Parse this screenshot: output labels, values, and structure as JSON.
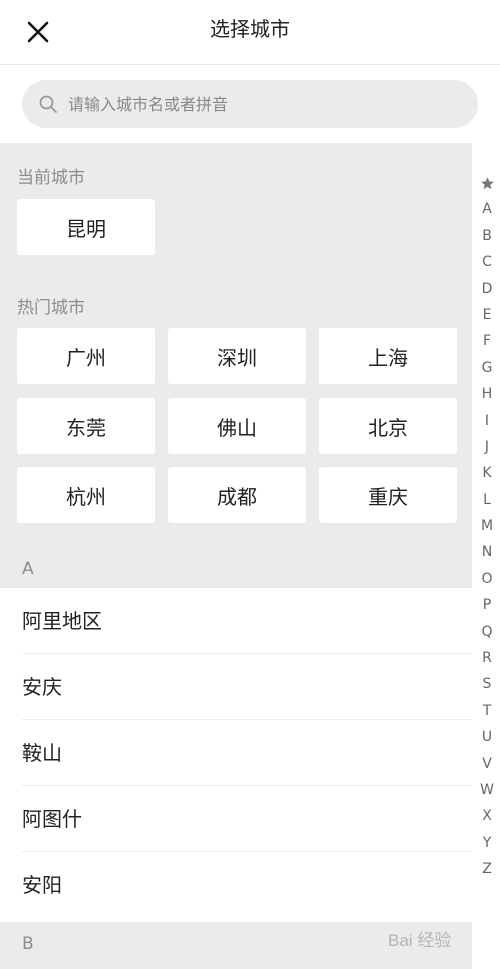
{
  "header": {
    "close_icon": "close-icon",
    "title": "选择城市"
  },
  "search": {
    "icon": "search-icon",
    "placeholder": "请输入城市名或者拼音",
    "value": ""
  },
  "current_city": {
    "title": "当前城市",
    "city": "昆明"
  },
  "hot_cities": {
    "title": "热门城市",
    "cities": [
      "广州",
      "深圳",
      "上海",
      "东莞",
      "佛山",
      "北京",
      "杭州",
      "成都",
      "重庆"
    ]
  },
  "groups": [
    {
      "letter": "A",
      "cities": [
        "阿里地区",
        "安庆",
        "鞍山",
        "阿图什",
        "安阳"
      ]
    },
    {
      "letter": "B",
      "cities": []
    }
  ],
  "index_bar": {
    "star_icon": "star-icon",
    "letters": [
      "A",
      "B",
      "C",
      "D",
      "E",
      "F",
      "G",
      "H",
      "I",
      "J",
      "K",
      "L",
      "M",
      "N",
      "O",
      "P",
      "Q",
      "R",
      "S",
      "T",
      "U",
      "V",
      "W",
      "X",
      "Y",
      "Z"
    ]
  },
  "watermark": {
    "text": "Bai 经验"
  },
  "colors": {
    "section_bg": "#ebebeb",
    "muted_text": "#8c8c8c",
    "text": "#222222"
  }
}
